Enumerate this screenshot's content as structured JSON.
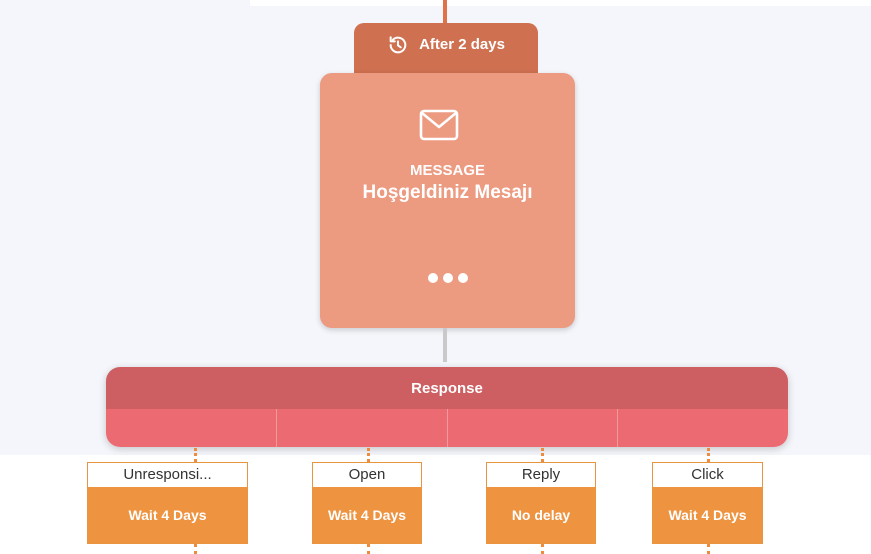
{
  "delay": {
    "label": "After 2 days",
    "icon": "history-icon"
  },
  "message": {
    "type": "MESSAGE",
    "name": "Hoşgeldiniz Mesajı",
    "icon": "mail-icon"
  },
  "response": {
    "title": "Response"
  },
  "branches": [
    {
      "label": "Unresponsi...",
      "wait": "Wait 4 Days"
    },
    {
      "label": "Open",
      "wait": "Wait 4 Days"
    },
    {
      "label": "Reply",
      "wait": "No delay"
    },
    {
      "label": "Click",
      "wait": "Wait 4 Days"
    }
  ],
  "colors": {
    "delay_pill": "#cf7051",
    "message_card": "#ec9a80",
    "response_header": "#cd5f63",
    "response_body": "#ec6b73",
    "branch_accent": "#ee9340"
  }
}
